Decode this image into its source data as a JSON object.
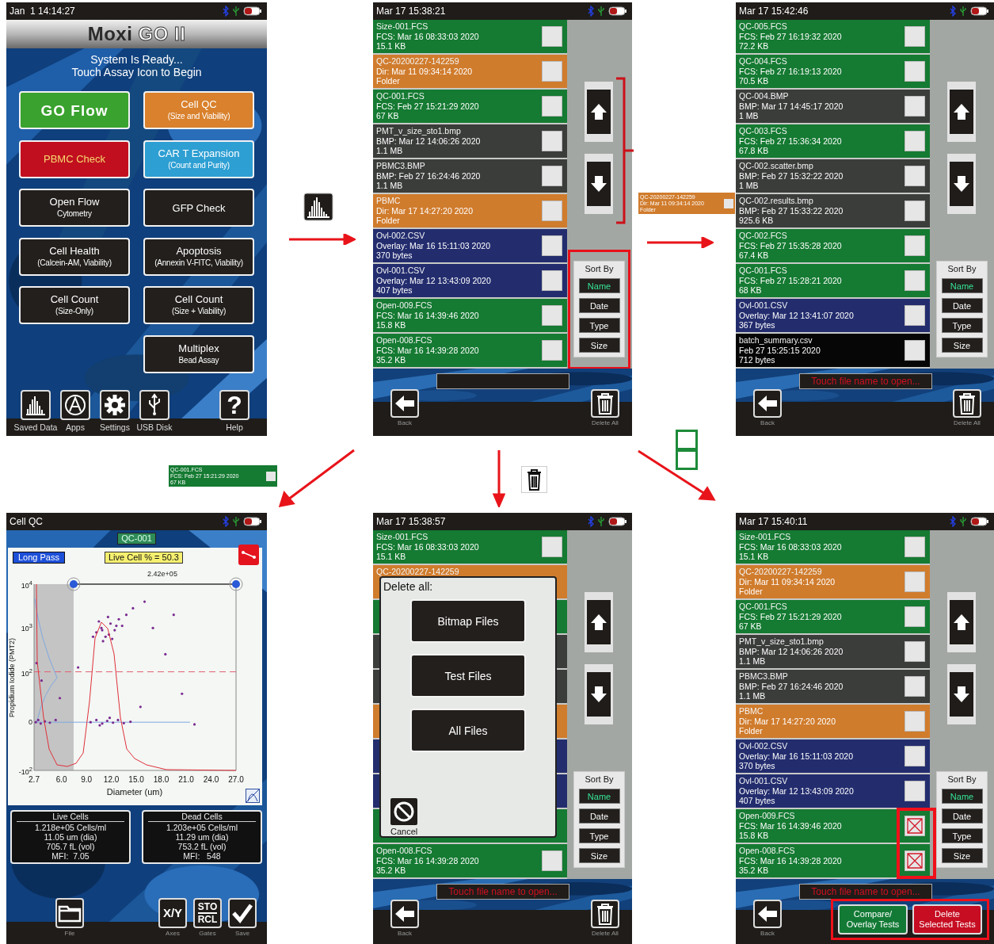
{
  "home": {
    "status": {
      "time": "Jan  1 14:14:27"
    },
    "logo": [
      "Moxi",
      "GO II"
    ],
    "subtitle": [
      "System Is Ready...",
      "Touch Assay Icon to Begin"
    ],
    "button_rows": [
      {
        "left": {
          "kind": "brand",
          "color": "#3aa22e",
          "lines": [
            "GO Flow"
          ]
        },
        "right": {
          "kind": "plain",
          "color": "#d9812c",
          "lines": [
            "Cell QC",
            "(Size and Viability)"
          ]
        }
      },
      {
        "left": {
          "kind": "alert",
          "color": "#c20f1f",
          "lines": [
            "PBMC Check"
          ]
        },
        "right": {
          "kind": "plain",
          "color": "#2e9fd3",
          "lines": [
            "CAR T Expansion",
            "(Count and Purity)"
          ]
        }
      },
      {
        "left": {
          "kind": "plain",
          "color": "#221f1c",
          "lines": [
            "Open Flow",
            "Cytometry"
          ]
        },
        "right": {
          "kind": "plain",
          "color": "#221f1c",
          "lines": [
            "GFP Check"
          ]
        }
      },
      {
        "left": {
          "kind": "plain",
          "color": "#221f1c",
          "lines": [
            "Cell Health",
            "(Calcein-AM, Viability)"
          ]
        },
        "right": {
          "kind": "plain",
          "color": "#221f1c",
          "lines": [
            "Apoptosis",
            "(Annexin V-FITC, Viability)"
          ]
        }
      },
      {
        "left": {
          "kind": "plain",
          "color": "#221f1c",
          "lines": [
            "Cell Count",
            "(Size-Only)"
          ]
        },
        "right": {
          "kind": "plain",
          "color": "#221f1c",
          "lines": [
            "Cell Count",
            "(Size + Viability)"
          ]
        }
      },
      {
        "right": {
          "kind": "plain",
          "color": "#221f1c",
          "lines": [
            "Multiplex",
            "Bead Assay"
          ]
        }
      }
    ],
    "toolbar": [
      {
        "kind": "bars",
        "label": "Saved Data"
      },
      {
        "kind": "apps",
        "label": "Apps"
      },
      {
        "kind": "gear",
        "label": "Settings"
      },
      {
        "kind": "usb",
        "label": "USB Disk"
      },
      {
        "kind": "help",
        "glyph": "?",
        "label": "Help"
      }
    ]
  },
  "step_open_folder": {
    "thumbnail": {
      "kind": "dir",
      "lines": [
        "QC-20200227-142259",
        "Dir: Mar 11 09:34:14 2020",
        "Folder"
      ]
    }
  },
  "step_open_test": {
    "thumbnail": {
      "kind": "fcs",
      "lines": [
        "QC-001.FCS",
        "FCS: Feb 27 15:21:29 2020",
        "67 KB"
      ]
    }
  },
  "file_screens": [
    {
      "status": {
        "time": "Mar 17 15:38:21"
      },
      "rows": [
        {
          "kind": "fcs",
          "name": "Size-001.FCS",
          "detail": "FCS: Mar 16 08:33:03 2020",
          "size": "15.1 KB",
          "checked": false
        },
        {
          "kind": "dir",
          "name": "QC-20200227-142259",
          "detail": "Dir: Mar 11 09:34:14 2020",
          "size": "Folder",
          "checked": false
        },
        {
          "kind": "fcs",
          "name": "QC-001.FCS",
          "detail": "FCS: Feb 27 15:21:29 2020",
          "size": "67 KB",
          "checked": false
        },
        {
          "kind": "bmp",
          "name": "PMT_v_size_sto1.bmp",
          "detail": "BMP: Mar 12 14:06:26 2020",
          "size": "1.1 MB",
          "checked": false
        },
        {
          "kind": "bmp",
          "name": "PBMC3.BMP",
          "detail": "BMP: Feb 27 16:24:46 2020",
          "size": "1.1 MB",
          "checked": false
        },
        {
          "kind": "dir",
          "name": "PBMC",
          "detail": "Dir: Mar 17 14:27:20 2020",
          "size": "Folder",
          "checked": false
        },
        {
          "kind": "overlay",
          "name": "Ovl-002.CSV",
          "detail": "Overlay: Mar 16 15:11:03 2020",
          "size": "370 bytes",
          "checked": false
        },
        {
          "kind": "overlay",
          "name": "Ovl-001.CSV",
          "detail": "Overlay: Mar 12 13:43:09 2020",
          "size": "407 bytes",
          "checked": false
        },
        {
          "kind": "fcs",
          "name": "Open-009.FCS",
          "detail": "FCS: Mar 16 14:39:46 2020",
          "size": "15.8 KB",
          "checked": false
        },
        {
          "kind": "fcs",
          "name": "Open-008.FCS",
          "detail": "FCS: Mar 16 14:39:28 2020",
          "size": "35.2 KB",
          "checked": false
        }
      ],
      "scroll": {
        "bracketed": true
      },
      "sort": {
        "title": "Sort By",
        "highlighted": true,
        "options": [
          {
            "label": "Name",
            "selected": true
          },
          {
            "label": "Date",
            "selected": false
          },
          {
            "label": "Type",
            "selected": false
          },
          {
            "label": "Size",
            "selected": false
          }
        ]
      },
      "footer": {
        "back": "Back",
        "delete_all": "Delete All"
      }
    },
    {
      "status": {
        "time": "Mar 17 15:42:46"
      },
      "rows": [
        {
          "kind": "fcs",
          "name": "QC-005.FCS",
          "detail": "FCS: Feb 27 16:19:32 2020",
          "size": "72.2 KB",
          "checked": false
        },
        {
          "kind": "fcs",
          "name": "QC-004.FCS",
          "detail": "FCS: Feb 27 16:19:13 2020",
          "size": "70.5 KB",
          "checked": false
        },
        {
          "kind": "bmp",
          "name": "QC-004.BMP",
          "detail": "BMP: Mar 17 14:45:17 2020",
          "size": "1 MB",
          "checked": false
        },
        {
          "kind": "fcs",
          "name": "QC-003.FCS",
          "detail": "FCS: Feb 27 15:36:34 2020",
          "size": "67.8 KB",
          "checked": false
        },
        {
          "kind": "bmp",
          "name": "QC-002.scatter.bmp",
          "detail": "BMP: Feb 27 15:32:22 2020",
          "size": "1 MB",
          "checked": false
        },
        {
          "kind": "bmp",
          "name": "QC-002.results.bmp",
          "detail": "BMP: Feb 27 15:33:22 2020",
          "size": "925.6 KB",
          "checked": false
        },
        {
          "kind": "fcs",
          "name": "QC-002.FCS",
          "detail": "FCS: Feb 27 15:35:28 2020",
          "size": "67.4 KB",
          "checked": false
        },
        {
          "kind": "fcs",
          "name": "QC-001.FCS",
          "detail": "FCS: Feb 27 15:28:21 2020",
          "size": "68 KB",
          "checked": false
        },
        {
          "kind": "overlay",
          "name": "Ovl-001.CSV",
          "detail": "Overlay: Mar 12 13:41:07 2020",
          "size": "367 bytes",
          "checked": false
        },
        {
          "kind": "csv",
          "name": "batch_summary.csv",
          "detail": "Feb 27 15:25:15 2020",
          "size": "712 bytes",
          "checked": false
        }
      ],
      "scroll": {
        "bracketed": false
      },
      "sort": {
        "title": "Sort By",
        "highlighted": false,
        "options": [
          {
            "label": "Name",
            "selected": true
          },
          {
            "label": "Date",
            "selected": false
          },
          {
            "label": "Type",
            "selected": false
          },
          {
            "label": "Size",
            "selected": false
          }
        ]
      },
      "message": "Touch file name to open...",
      "footer": {
        "back": "Back",
        "delete_all": "Delete All"
      }
    },
    {
      "status": {
        "time": "Mar 17 15:38:57"
      },
      "rows": [
        {
          "kind": "fcs",
          "name": "Size-001.FCS",
          "detail": "FCS: Mar 16 08:33:03 2020",
          "size": "15.1 KB",
          "checked": false
        },
        {
          "kind": "dir",
          "name": "QC-20200227-142259"
        },
        {
          "kind": "fcs"
        },
        {
          "kind": "bmp"
        },
        {
          "kind": "bmp"
        },
        {
          "kind": "dir"
        },
        {
          "kind": "overlay"
        },
        {
          "kind": "overlay"
        },
        {
          "kind": "fcs"
        },
        {
          "kind": "fcs",
          "name": "Open-008.FCS",
          "detail": "FCS: Mar 16 14:39:28 2020",
          "size": "35.2 KB",
          "checked": false
        }
      ],
      "scroll": {
        "bracketed": false
      },
      "sort": {
        "title": "Sort By",
        "highlighted": false,
        "options": [
          {
            "label": "Name",
            "selected": true
          },
          {
            "label": "Date",
            "selected": false
          },
          {
            "label": "Type",
            "selected": false
          },
          {
            "label": "Size",
            "selected": false
          }
        ]
      },
      "dialog": {
        "title": "Delete all:",
        "options": [
          "Bitmap Files",
          "Test Files",
          "All Files"
        ],
        "cancel": "Cancel"
      },
      "message": "Touch file name to open...",
      "footer": {
        "back": "Back",
        "delete_all": "Delete All"
      }
    },
    {
      "status": {
        "time": "Mar 17 15:40:11"
      },
      "rows": [
        {
          "kind": "fcs",
          "name": "Size-001.FCS",
          "detail": "FCS: Mar 16 08:33:03 2020",
          "size": "15.1 KB",
          "checked": false,
          "marked": false
        },
        {
          "kind": "dir",
          "name": "QC-20200227-142259",
          "detail": "Dir: Mar 11 09:34:14 2020",
          "size": "Folder",
          "checked": false,
          "marked": false
        },
        {
          "kind": "fcs",
          "name": "QC-001.FCS",
          "detail": "FCS: Feb 27 15:21:29 2020",
          "size": "67 KB",
          "checked": false,
          "marked": false
        },
        {
          "kind": "bmp",
          "name": "PMT_v_size_sto1.bmp",
          "detail": "BMP: Mar 12 14:06:26 2020",
          "size": "1.1 MB",
          "checked": false,
          "marked": false
        },
        {
          "kind": "bmp",
          "name": "PBMC3.BMP",
          "detail": "BMP: Feb 27 16:24:46 2020",
          "size": "1.1 MB",
          "checked": false,
          "marked": false
        },
        {
          "kind": "dir",
          "name": "PBMC",
          "detail": "Dir: Mar 17 14:27:20 2020",
          "size": "Folder",
          "checked": false,
          "marked": false
        },
        {
          "kind": "overlay",
          "name": "Ovl-002.CSV",
          "detail": "Overlay: Mar 16 15:11:03 2020",
          "size": "370 bytes",
          "checked": false,
          "marked": false
        },
        {
          "kind": "overlay",
          "name": "Ovl-001.CSV",
          "detail": "Overlay: Mar 12 13:43:09 2020",
          "size": "407 bytes",
          "checked": false,
          "marked": false
        },
        {
          "kind": "fcs",
          "name": "Open-009.FCS",
          "detail": "FCS: Mar 16 14:39:46 2020",
          "size": "15.8 KB",
          "checked": true,
          "marked": true
        },
        {
          "kind": "fcs",
          "name": "Open-008.FCS",
          "detail": "FCS: Mar 16 14:39:28 2020",
          "size": "35.2 KB",
          "checked": true,
          "marked": true
        }
      ],
      "scroll": {
        "bracketed": false
      },
      "sort": {
        "title": "Sort By",
        "highlighted": false,
        "options": [
          {
            "label": "Name",
            "selected": true
          },
          {
            "label": "Date",
            "selected": false
          },
          {
            "label": "Type",
            "selected": false
          },
          {
            "label": "Size",
            "selected": false
          }
        ]
      },
      "message": "Touch file name to open...",
      "footer": {
        "back": "Back",
        "highlighted": true,
        "actions": [
          {
            "color": "#137a36",
            "lines": [
              "Compare/",
              "Overlay Tests"
            ]
          },
          {
            "color": "#c60d22",
            "lines": [
              "Delete",
              "Selected Tests"
            ]
          }
        ]
      }
    }
  ],
  "cell_qc": {
    "status": {
      "title": "Cell QC"
    },
    "test_name": "QC-001",
    "filter": "Long Pass",
    "live_percent": "Live Cell % = 50.3",
    "gate_value": "2.42e+05",
    "plot": {
      "xlabel": "Diameter (um)",
      "ylabel": "Propidium Iodide (PMT2)",
      "x_ticks": [
        "2.7",
        "6.0",
        "9.0",
        "12.0",
        "15.0",
        "18.0",
        "21.0",
        "24.0",
        "27.0"
      ],
      "y_ticks": [
        "10$^{4}$",
        "10$^{3}$",
        "10$^{2}$",
        "0",
        "-10$^{2}$"
      ]
    },
    "stats": [
      {
        "title": "Live Cells",
        "lines": [
          "1.218e+05 Cells/ml",
          "11.05 um (dia)",
          "705.7 fL (vol)",
          "MFI:  7.05"
        ]
      },
      {
        "title": "Dead Cells",
        "lines": [
          "1.203e+05 Cells/ml",
          "11.29 um (dia)",
          "753.2 fL (vol)",
          "MFI:   548"
        ]
      }
    ],
    "toolbar": [
      {
        "kind": "file",
        "label": "File"
      },
      {
        "kind": "axes",
        "glyphs": [
          "X/Y"
        ],
        "label": "Axes"
      },
      {
        "kind": "gates",
        "glyphs": [
          "STO",
          "RCL"
        ],
        "label": "Gates"
      },
      {
        "kind": "save",
        "label": "Save"
      }
    ]
  }
}
